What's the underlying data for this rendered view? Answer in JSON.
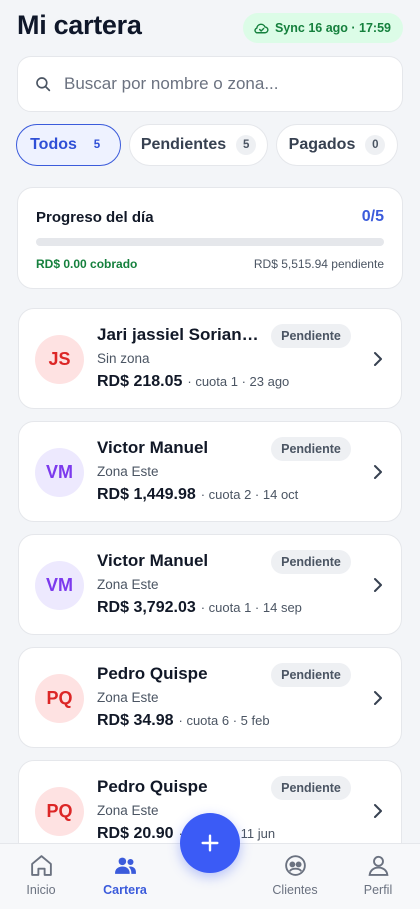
{
  "header": {
    "title": "Mi cartera",
    "sync_label": "Sync 16 ago · 17:59",
    "sync_icon": "cloud-check-icon"
  },
  "search": {
    "placeholder": "Buscar por nombre o zona...",
    "value": ""
  },
  "filters": [
    {
      "label": "Todos",
      "count": "5",
      "active": true
    },
    {
      "label": "Pendientes",
      "count": "5",
      "active": false
    },
    {
      "label": "Pagados",
      "count": "0",
      "active": false
    }
  ],
  "progress": {
    "title": "Progreso del día",
    "ratio": "0/5",
    "fraction": 0,
    "collected": "RD$ 0.00 cobrado",
    "pending": "RD$ 5,515.94 pendiente"
  },
  "loans": [
    {
      "initials": "JS",
      "avatar_tone": "red",
      "name": "Jari jassiel Soriano…",
      "zone": "Sin zona",
      "amount": "RD$ 218.05",
      "meta": "· cuota 1 · 23 ago",
      "status": "Pendiente"
    },
    {
      "initials": "VM",
      "avatar_tone": "purple",
      "name": "Victor Manuel",
      "zone": "Zona Este",
      "amount": "RD$ 1,449.98",
      "meta": "· cuota 2 · 14 oct",
      "status": "Pendiente"
    },
    {
      "initials": "VM",
      "avatar_tone": "purple",
      "name": "Victor Manuel",
      "zone": "Zona Este",
      "amount": "RD$ 3,792.03",
      "meta": "· cuota 1 · 14 sep",
      "status": "Pendiente"
    },
    {
      "initials": "PQ",
      "avatar_tone": "red",
      "name": "Pedro Quispe",
      "zone": "Zona Este",
      "amount": "RD$ 34.98",
      "meta": "· cuota 6 · 5 feb",
      "status": "Pendiente"
    },
    {
      "initials": "PQ",
      "avatar_tone": "red",
      "name": "Pedro Quispe",
      "zone": "Zona Este",
      "amount": "RD$ 20.90",
      "meta": "· cuota 5 · 11 jun",
      "status": "Pendiente"
    }
  ],
  "nav": {
    "items": [
      {
        "label": "Inicio",
        "icon": "home-icon",
        "active": false
      },
      {
        "label": "Cartera",
        "icon": "users-icon",
        "active": true
      },
      {
        "label": "Clientes",
        "icon": "clients-icon",
        "active": false
      },
      {
        "label": "Perfil",
        "icon": "profile-icon",
        "active": false
      }
    ],
    "fab_icon": "plus-icon"
  },
  "colors": {
    "accent": "#3b5bdb",
    "fab": "#3b5bf6",
    "success": "#15803d",
    "sync_bg": "#dcfce7"
  }
}
